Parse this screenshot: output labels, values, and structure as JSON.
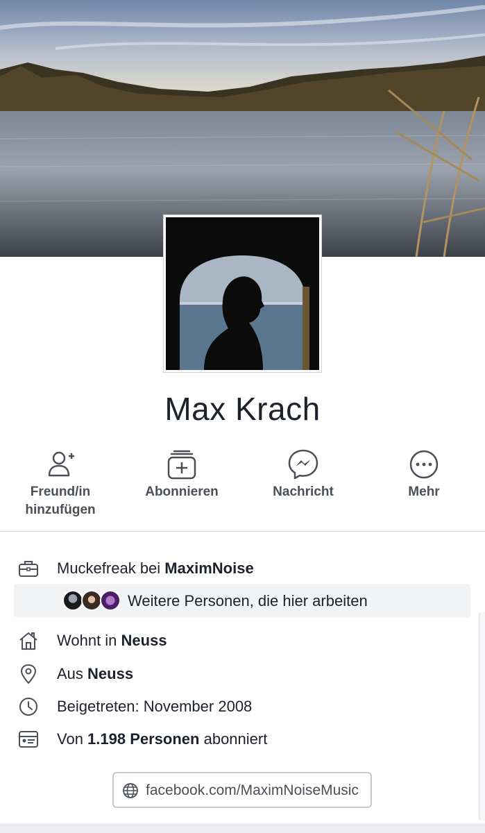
{
  "profile": {
    "name": "Max Krach"
  },
  "actions": [
    {
      "label": "Freund/in\nhinzufügen",
      "icon": "add-friend-icon"
    },
    {
      "label": "Abonnieren",
      "icon": "follow-icon"
    },
    {
      "label": "Nachricht",
      "icon": "messenger-icon"
    },
    {
      "label": "Mehr",
      "icon": "more-icon"
    }
  ],
  "intro": {
    "work_prefix": "Muckefreak bei ",
    "work_place": "MaximNoise",
    "coworkers_text": "Weitere Personen, die hier arbeiten",
    "lives_prefix": "Wohnt in ",
    "lives_place": "Neuss",
    "from_prefix": "Aus ",
    "from_place": "Neuss",
    "joined": "Beigetreten: November 2008",
    "followers_prefix": "Von ",
    "followers_count": "1.198 Personen",
    "followers_suffix": " abonniert",
    "website": "facebook.com/MaximNoiseMusic"
  },
  "icons": {
    "work": "briefcase-icon",
    "home": "house-icon",
    "location": "location-pin-icon",
    "joined": "clock-icon",
    "followers": "followers-card-icon",
    "website": "globe-icon"
  },
  "colors": {
    "text": "#1d2129",
    "secondary_text": "#4b4f56",
    "icon_stroke": "#4b4f56",
    "divider": "#dadde1",
    "coworkers_bg": "#f2f3f5"
  }
}
